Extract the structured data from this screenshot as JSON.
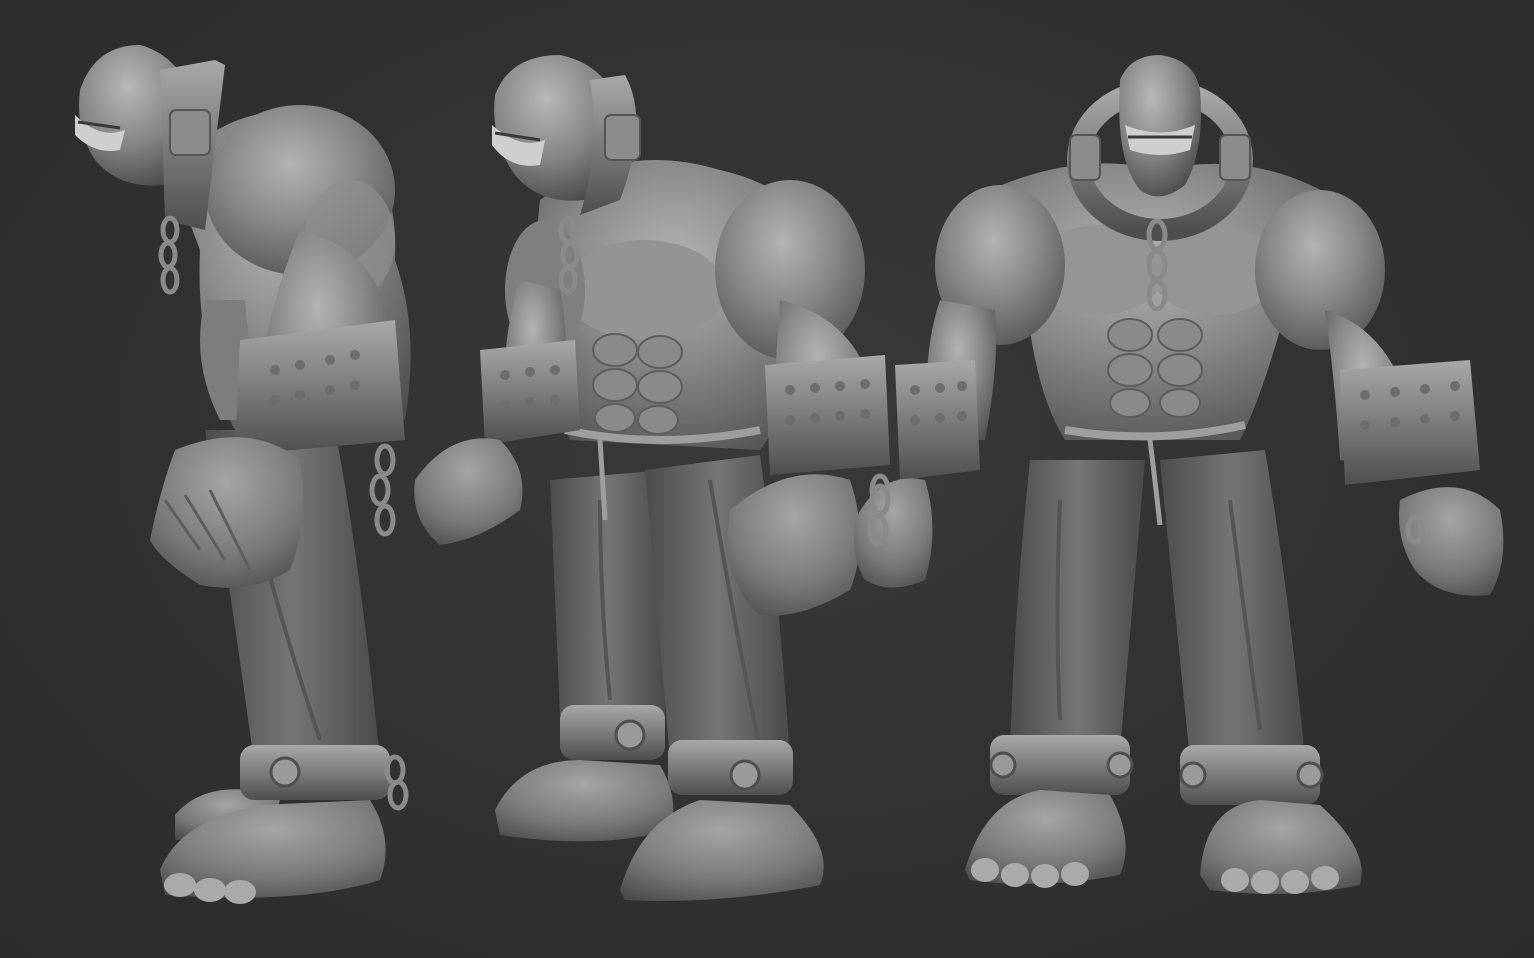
{
  "scene": {
    "background_color": "#302f30",
    "clay_color": "#8e8e8e",
    "clay_shadow": "#5a5a5a",
    "clay_highlight": "#bdbdbd",
    "figures": [
      {
        "view": "side",
        "icon": "ogre-side-view"
      },
      {
        "view": "three-quarter",
        "icon": "ogre-three-quarter-view"
      },
      {
        "view": "front",
        "icon": "ogre-front-view"
      }
    ]
  }
}
